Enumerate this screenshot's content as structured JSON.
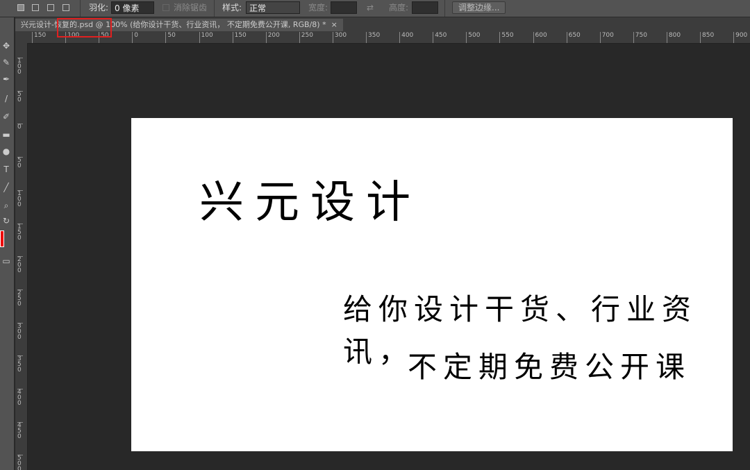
{
  "options_bar": {
    "feather_label": "羽化:",
    "feather_value": "0 像素",
    "antialias_label": "消除锯齿",
    "style_label": "样式:",
    "style_value": "正常",
    "width_label": "宽度:",
    "height_label": "高度:",
    "refine_edge_button": "调整边缘..."
  },
  "document_tab": {
    "title": "兴元设计-恢复的.psd @ 100% (给你设计干货、行业资讯， 不定期免费公开课, RGB/8) *",
    "close": "×"
  },
  "highlight_color": "#e02020",
  "ruler": {
    "horizontal": [
      "150",
      "100",
      "50",
      "0",
      "50",
      "100",
      "150",
      "200",
      "250",
      "300",
      "350",
      "400",
      "450",
      "500",
      "550",
      "600",
      "650",
      "700",
      "750",
      "800",
      "850",
      "900"
    ],
    "vertical": [
      "100",
      "50",
      "0",
      "50",
      "100",
      "150",
      "200",
      "250",
      "300",
      "350",
      "400",
      "450",
      "500"
    ]
  },
  "canvas": {
    "title": "兴元设计",
    "line1": "给你设计干货、行业资讯，",
    "line2": "不定期免费公开课"
  },
  "tools": [
    "move-icon",
    "brush-icon",
    "eyedropper-icon",
    "pen-brush-icon",
    "history-brush-icon",
    "gradient-icon",
    "dodge-icon",
    "type-icon",
    "line-icon",
    "zoom-icon",
    "rotate-icon",
    "foreground-color",
    "screen-mode-icon"
  ]
}
